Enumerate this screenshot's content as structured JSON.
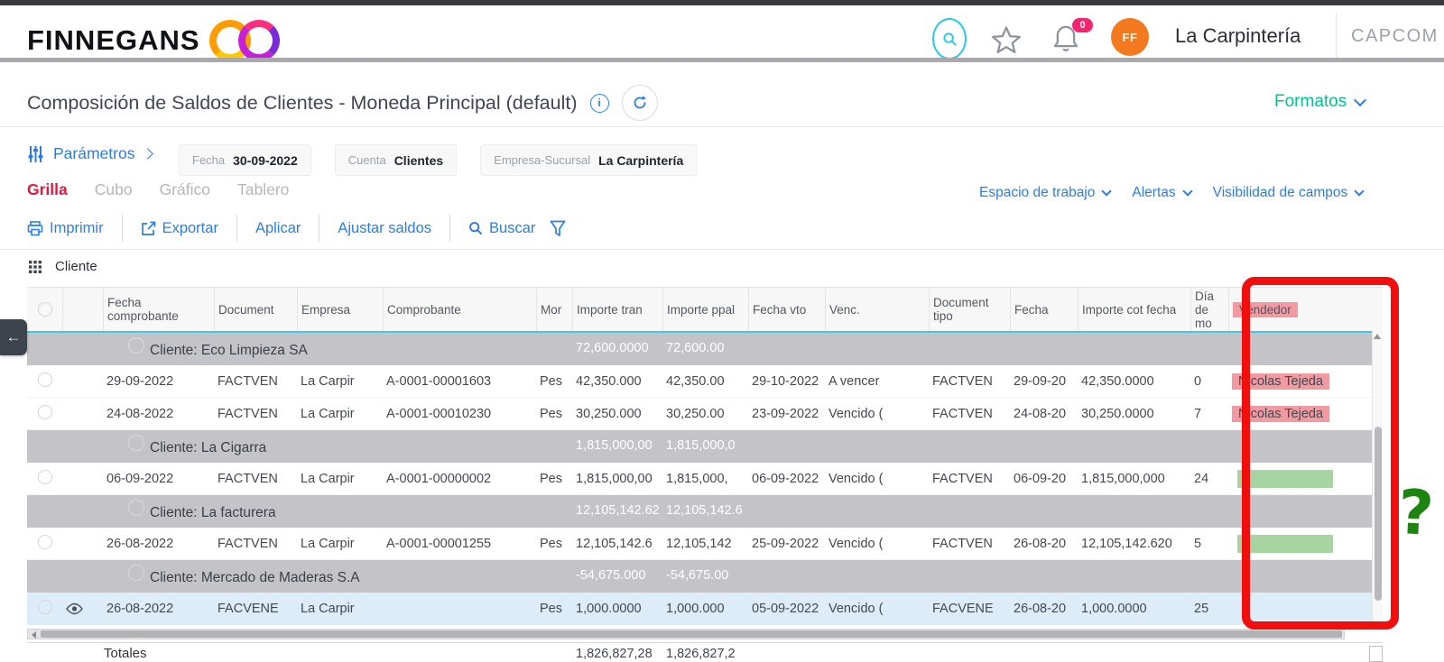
{
  "topbar": {
    "logo_text": "FINNEGANS",
    "icons": [
      "search-icon",
      "star-icon",
      "bell-icon"
    ],
    "notification_count": "0",
    "avatar_initials": "FF",
    "tenant": "La Carpintería",
    "org": "CAPCOM"
  },
  "page": {
    "title": "Composición de Saldos de Clientes - Moneda Principal (default)",
    "title_icons": [
      "info-icon",
      "refresh-icon"
    ],
    "formats_label": "Formatos"
  },
  "parameters": {
    "icon": "sliders-icon",
    "label": "Parámetros",
    "fields": [
      {
        "label": "Fecha",
        "value": "30-09-2022"
      },
      {
        "label": "Cuenta",
        "value": "Clientes"
      },
      {
        "label": "Empresa-Sucursal",
        "value": "La Carpintería"
      }
    ]
  },
  "view_tabs": [
    {
      "label": "Grilla",
      "active": true
    },
    {
      "label": "Cubo",
      "active": false
    },
    {
      "label": "Gráfico",
      "active": false
    },
    {
      "label": "Tablero",
      "active": false
    }
  ],
  "quick_links": [
    "Espacio de trabajo",
    "Alertas",
    "Visibilidad de campos"
  ],
  "toolbar": {
    "items": [
      {
        "icon": "printer-icon",
        "label": "Imprimir"
      },
      {
        "icon": "export-icon",
        "label": "Exportar"
      },
      {
        "icon": "",
        "label": "Aplicar"
      },
      {
        "icon": "",
        "label": "Ajustar saldos"
      },
      {
        "icon": "search-icon",
        "label": "Buscar"
      }
    ],
    "filter_icon": "filter-icon"
  },
  "grouping": {
    "icon": "grid-icon",
    "label": "Cliente"
  },
  "table": {
    "columns": [
      {
        "key": "select",
        "label": ""
      },
      {
        "key": "indicator",
        "label": ""
      },
      {
        "key": "fecha_comprobante",
        "label": "Fecha comprobante"
      },
      {
        "key": "documento",
        "label": "Document"
      },
      {
        "key": "empresa",
        "label": "Empresa"
      },
      {
        "key": "comprobante",
        "label": "Comprobante"
      },
      {
        "key": "moneda",
        "label": "Mor"
      },
      {
        "key": "importe_tran",
        "label": "Importe tran"
      },
      {
        "key": "importe_ppal",
        "label": "Importe ppal"
      },
      {
        "key": "fecha_vto",
        "label": "Fecha vto"
      },
      {
        "key": "venc",
        "label": "Venc."
      },
      {
        "key": "documento_tipo",
        "label": "Document tipo"
      },
      {
        "key": "fecha",
        "label": "Fecha"
      },
      {
        "key": "importe_cot_fecha",
        "label": "Importe cot fecha"
      },
      {
        "key": "dias_mora",
        "label": "Día de mo"
      },
      {
        "key": "vendedor",
        "label": "Vendedor"
      }
    ],
    "rows": [
      {
        "type": "group",
        "label": "Cliente: Eco Limpieza SA",
        "importe_tran": "72,600.0000",
        "importe_ppal": "72,600.00"
      },
      {
        "type": "data",
        "vendedor_style": "pink",
        "eye": false,
        "selected": false,
        "cells": [
          "29-09-2022",
          "FACTVEN",
          "La Carpir",
          "A-0001-00001603",
          "Pes",
          "42,350.000",
          "42,350.00",
          "29-10-2022",
          "A vencer",
          "FACTVEN",
          "29-09-20",
          "42,350.0000",
          "0",
          "Nicolas Tejeda"
        ]
      },
      {
        "type": "data",
        "vendedor_style": "pink",
        "eye": false,
        "selected": false,
        "cells": [
          "24-08-2022",
          "FACTVEN",
          "La Carpir",
          "A-0001-00010230",
          "Pes",
          "30,250.000",
          "30,250.00",
          "23-09-2022",
          "Vencido (",
          "FACTVEN",
          "24-08-20",
          "30,250.0000",
          "7",
          "Nicolas Tejeda"
        ]
      },
      {
        "type": "group",
        "label": "Cliente: La Cigarra",
        "importe_tran": "1,815,000,00",
        "importe_ppal": "1,815,000,0"
      },
      {
        "type": "data",
        "vendedor_style": "green",
        "eye": false,
        "selected": false,
        "cells": [
          "06-09-2022",
          "FACTVEN",
          "La Carpir",
          "A-0001-00000002",
          "Pes",
          "1,815,000,00",
          "1,815,000,",
          "06-09-2022",
          "Vencido (",
          "FACTVEN",
          "06-09-20",
          "1,815,000,000",
          "24",
          ""
        ]
      },
      {
        "type": "group",
        "label": "Cliente: La facturera",
        "importe_tran": "12,105,142.62",
        "importe_ppal": "12,105,142.6"
      },
      {
        "type": "data",
        "vendedor_style": "green",
        "eye": false,
        "selected": false,
        "cells": [
          "26-08-2022",
          "FACTVEN",
          "La Carpir",
          "A-0001-00001255",
          "Pes",
          "12,105,142.6",
          "12,105,142",
          "25-09-2022",
          "Vencido (",
          "FACTVEN",
          "26-08-20",
          "12,105,142.620",
          "5",
          ""
        ]
      },
      {
        "type": "group",
        "label": "Cliente: Mercado de Maderas S.A",
        "importe_tran": "-54,675.000",
        "importe_ppal": "-54,675.00"
      },
      {
        "type": "data",
        "vendedor_style": null,
        "eye": true,
        "selected": true,
        "cells": [
          "26-08-2022",
          "FACVENE",
          "La Carpir",
          "",
          "Pes",
          "1,000.0000",
          "1,000.000",
          "05-09-2022",
          "Vencido (",
          "FACVENE",
          "26-08-20",
          "1,000.0000",
          "25",
          ""
        ]
      }
    ],
    "totals": {
      "label": "Totales",
      "importe_tran": "1,826,827,28",
      "importe_ppal": "1,826,827,2"
    }
  },
  "annotations": {
    "question_mark": "?",
    "red_box": "vendedor-column-highlight"
  },
  "colors": {
    "accent_blue": "#2b7de9",
    "formats_green": "#03c38b",
    "active_tab_red": "#e5173f",
    "pink_highlight": "#f19aa1",
    "green_highlight": "#a7d5a1",
    "annotation_red": "#f10f0d",
    "annotation_green": "#1d8412",
    "selected_row": "#dcecf8",
    "group_row_gray": "#c4c4c8",
    "avatar_orange": "#f47a20",
    "badge_pink": "#f3256e",
    "search_cyan": "#25c8e8",
    "header_underline_cyan": "#41c8e2"
  }
}
